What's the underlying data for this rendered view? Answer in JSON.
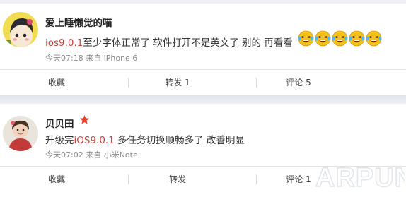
{
  "posts": [
    {
      "user": {
        "name": "爱上睡懒觉的喵",
        "verified_star": false
      },
      "content": {
        "highlight": "ios9.0.1",
        "text": "至少字体正常了 软件打开不是英文了 别的 再看看"
      },
      "emoji_icons": [
        "laughing-tears-emoji",
        "laughing-tears-emoji",
        "laughing-tears-emoji",
        "laughing-tears-emoji",
        "laughing-tears-emoji"
      ],
      "meta": "今天07:18 来自 iPhone 6",
      "actions": {
        "favorite": "收藏",
        "repost": "转发 1",
        "comment": "评论 5"
      }
    },
    {
      "user": {
        "name": "贝贝田",
        "verified_star": true
      },
      "content": {
        "prefix": "升级完",
        "highlight": "iOS9.0.1",
        "text": " 多任务切换顺畅多了 改善明显"
      },
      "meta": "今天07:02 来自 小米Note",
      "actions": {
        "favorite": "收藏",
        "repost": "转发",
        "comment": "评论 1"
      }
    }
  ],
  "watermark": "ARPUN",
  "colors": {
    "highlight": "#d43f3a",
    "star": "#e8412c",
    "emoji": "#f5c01a"
  }
}
